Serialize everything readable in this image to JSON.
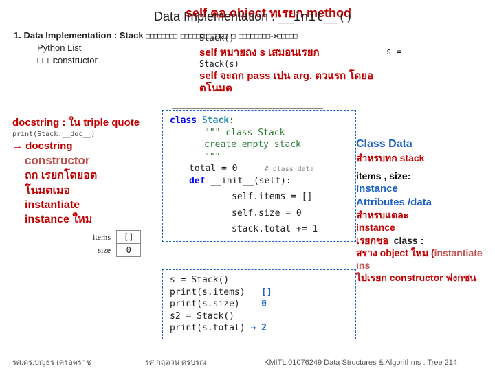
{
  "header": {
    "top_annotation": "self คอ object ทเรยก method",
    "title_prefix": "Data Implementation : ",
    "title_code": "__init__()"
  },
  "bullets": {
    "num": "1.",
    "line1": "Data Implementation : Stack ",
    "line1_boxes": "□□□□□□□□ □□□□□□□□□□□□ □ □□□□□□□□->□□□□□",
    "line2": "Python List",
    "line3": "□□□constructor",
    "stack_call": "Stack()",
    "s_eq": "s =",
    "stack_s": "Stack(s)",
    "self_means": "self หมายถง  s เสมอนเรยก",
    "self_pass": "self จะถก pass เปน  arg. ตวแรก โดยอตโนมต"
  },
  "left": {
    "docstring": "docstring : ใน triple quote",
    "print": "print(Stack.__doc__)",
    "arrow_doc": "→ docstring",
    "constructor": "constructor",
    "l1": "ถก เรยกโดยอต",
    "l2": "โนมตเมอ",
    "l3": "instantiate",
    "l4": "instance ใหม"
  },
  "table": {
    "r1_label": "items",
    "r1_val": "[]",
    "r2_label": "size",
    "r2_val": "0"
  },
  "code": {
    "c1_a": "class ",
    "c1_b": "Stack",
    "c1_c": ":",
    "c2": "\"\"\" class Stack",
    "c3": "    create empty stack",
    "c4": "\"\"\"",
    "c5_a": "total = 0",
    "c5_com": "# class data",
    "c6_a": "def ",
    "c6_b": "__init__",
    "c6_c": "(self):",
    "c7": "self.items = []",
    "c8": "self.size = 0",
    "c9": "stack.total  += 1"
  },
  "code2": {
    "u1": "s = Stack()",
    "u2": "print(s.items)",
    "u2_out": "[]",
    "u3": "print(s.size)",
    "u3_out": "0",
    "u4": "s2 = Stack()",
    "u5": "print(s.total)",
    "u5_out": "2"
  },
  "right": {
    "r1": "Class Data",
    "r2": "สำหรบทก      stack",
    "r3": "items , size:",
    "r4": "Instance",
    "r5": "Attributes /data",
    "r6": "สำหรบแตละ",
    "r7": "instance",
    "r8": "class :",
    "r8b": "เรยกชอ",
    "r9": "สราง object ใหม (",
    "r9b": "instantiate ins",
    "r10": "ไปเรยก constructor ฟงกชน"
  },
  "footer": {
    "f1": "รศ.ดร.บญธร    เครอตราช",
    "f2": "รศ.กฤตวน   ศรบรณ",
    "f3": "KMITL   01076249 Data Structures & Algorithms : Tree 214"
  }
}
